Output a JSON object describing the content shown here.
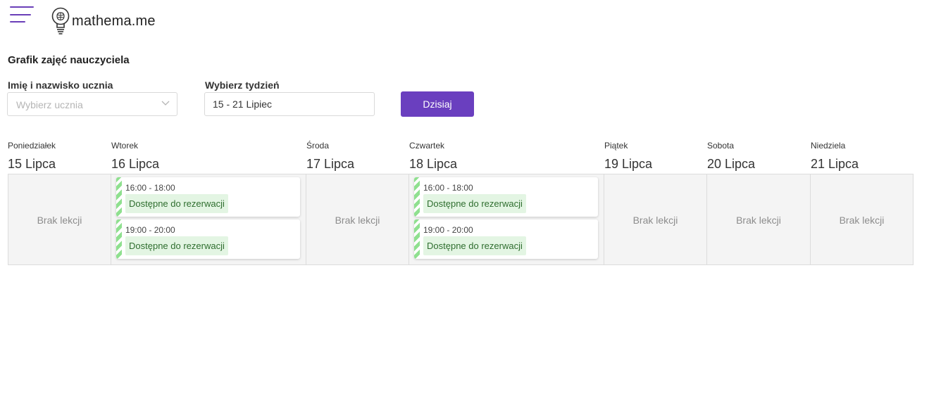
{
  "header": {
    "logo_text": "mathema.me",
    "accent_color": "#6a3fbf"
  },
  "page": {
    "title": "Grafik zajęć nauczyciela"
  },
  "filters": {
    "student_label": "Imię i nazwisko ucznia",
    "student_placeholder": "Wybierz ucznia",
    "week_label": "Wybierz tydzień",
    "week_value": "15 - 21 Lipiec",
    "today_button": "Dzisiaj"
  },
  "days": [
    {
      "name": "Poniedziałek",
      "date": "15 Lipca",
      "empty": "Brak lekcji"
    },
    {
      "name": "Wtorek",
      "date": "16 Lipca",
      "slots": [
        {
          "time": "16:00 - 18:00",
          "status": "Dostępne do rezerwacji"
        },
        {
          "time": "19:00 - 20:00",
          "status": "Dostępne do rezerwacji"
        }
      ]
    },
    {
      "name": "Środa",
      "date": "17 Lipca",
      "empty": "Brak lekcji"
    },
    {
      "name": "Czwartek",
      "date": "18 Lipca",
      "slots": [
        {
          "time": "16:00 - 18:00",
          "status": "Dostępne do rezerwacji"
        },
        {
          "time": "19:00 - 20:00",
          "status": "Dostępne do rezerwacji"
        }
      ]
    },
    {
      "name": "Piątek",
      "date": "19 Lipca",
      "empty": "Brak lekcji"
    },
    {
      "name": "Sobota",
      "date": "20 Lipca",
      "empty": "Brak lekcji"
    },
    {
      "name": "Niedziela",
      "date": "21 Lipca",
      "empty": "Brak lekcji"
    }
  ]
}
